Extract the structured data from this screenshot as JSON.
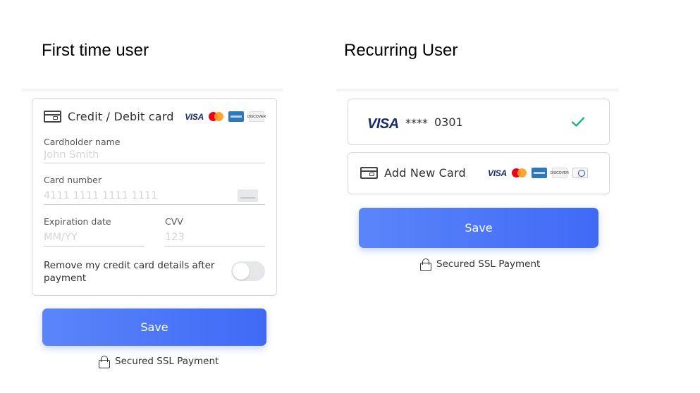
{
  "headings": {
    "first_time": "First time user",
    "recurring": "Recurring User"
  },
  "first_time_form": {
    "title": "Credit / Debit card",
    "brands": [
      "VISA",
      "mastercard",
      "amex",
      "DISCOVER"
    ],
    "cardholder_label": "Cardholder name",
    "cardholder_placeholder": "John Smith",
    "card_number_label": "Card number",
    "card_number_placeholder": "4111 1111 1111 1111",
    "expiration_label": "Expiration date",
    "expiration_placeholder": "MM/YY",
    "cvv_label": "CVV",
    "cvv_placeholder": "123",
    "remove_details_text": "Remove my credit card details after payment",
    "remove_details_toggle": false,
    "save_label": "Save",
    "ssl_text": "Secured SSL Payment"
  },
  "recurring_user": {
    "saved_card": {
      "brand": "VISA",
      "masked": "****",
      "last4": "0301",
      "selected": true
    },
    "add_card_label": "Add New Card",
    "brands": [
      "VISA",
      "mastercard",
      "amex",
      "DISCOVER",
      "Diners Club"
    ],
    "save_label": "Save",
    "ssl_text": "Secured SSL Payment"
  },
  "colors": {
    "primary": "#4a76f8",
    "check": "#21b37e",
    "visa": "#1a2a6c"
  }
}
